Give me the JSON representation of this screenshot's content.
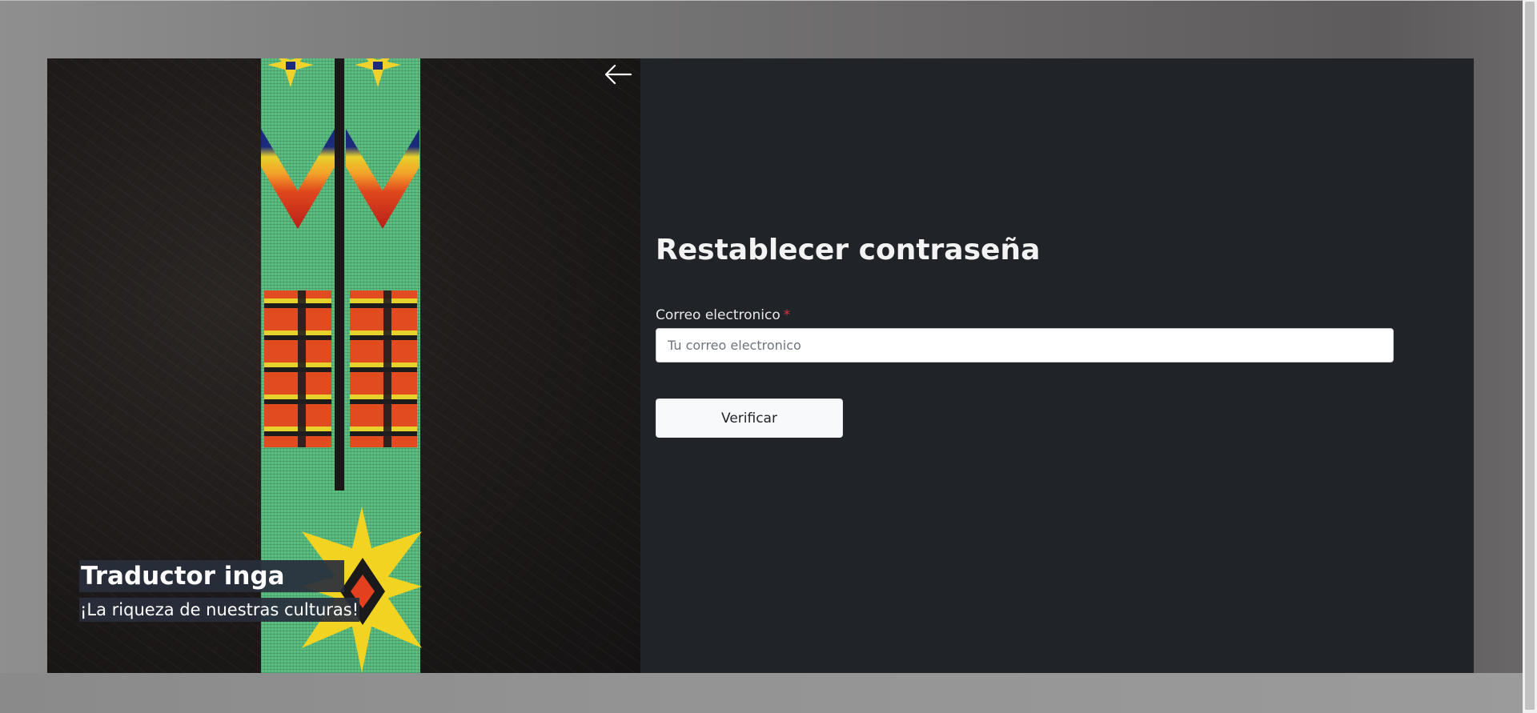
{
  "hero": {
    "title": "Traductor inga",
    "subtitle": "¡La riqueza de nuestras culturas!"
  },
  "form": {
    "title": "Restablecer contraseña",
    "email_label": "Correo electronico",
    "required_mark": "*",
    "email_placeholder": "Tu correo electronico",
    "email_value": "",
    "submit_label": "Verificar"
  },
  "icons": {
    "back": "arrow-left-icon"
  },
  "colors": {
    "panel_background": "#202328",
    "required_mark": "#e0343d",
    "button_background": "#f8f9fa"
  }
}
